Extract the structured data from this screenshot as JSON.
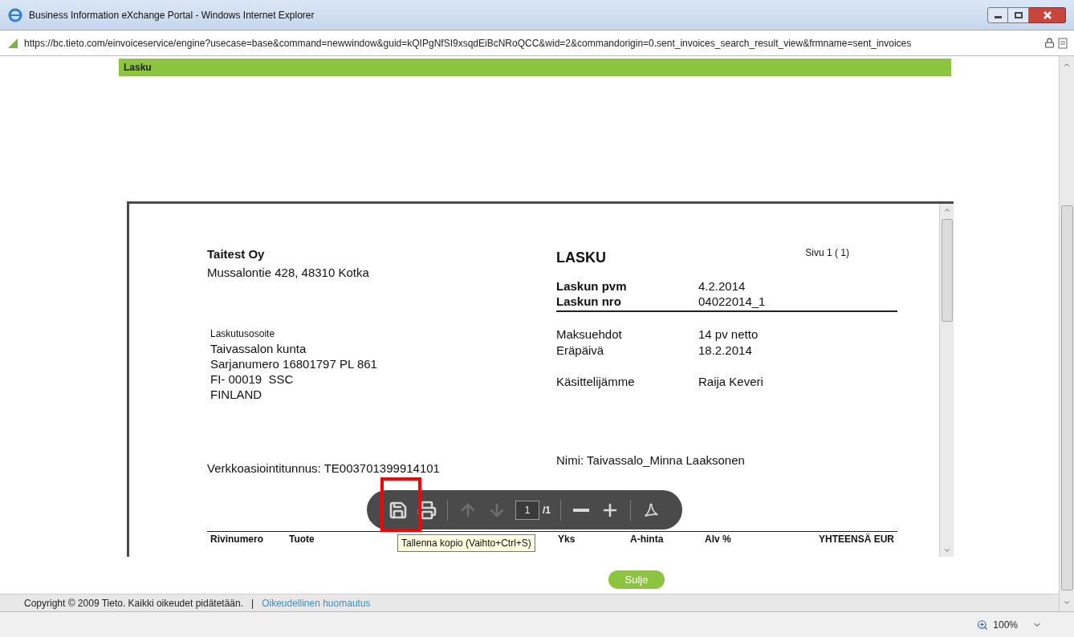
{
  "window": {
    "title": "Business Information eXchange Portal - Windows Internet Explorer"
  },
  "address_bar": {
    "url": "https://bc.tieto.com/einvoiceservice/engine?usecase=base&command=newwindow&guid=kQIPgNfSI9xsqdEiBcNRoQCC&wid=2&commandorigin=0.sent_invoices_search_result_view&frmname=sent_invoices"
  },
  "section_bar": {
    "title": "Lasku"
  },
  "invoice": {
    "seller": {
      "name": "Taitest Oy",
      "address": "Mussalontie 428, 48310 Kotka"
    },
    "title": "LASKU",
    "page": "Sivu 1 ( 1)",
    "header_fields": [
      {
        "label": "Laskun pvm",
        "value": "4.2.2014"
      },
      {
        "label": "Laskun nro",
        "value": "04022014_1"
      }
    ],
    "billing_address": {
      "label": "Laskutusosoite",
      "lines": [
        "Taivassalon kunta",
        "Sarjanumero 16801797 PL 861",
        "FI- 00019  SSC",
        "FINLAND"
      ]
    },
    "terms": [
      {
        "label": "Maksuehdot",
        "value": "14 pv netto"
      },
      {
        "label": "Eräpäivä",
        "value": "18.2.2014"
      }
    ],
    "handler": {
      "label": "Käsittelijämme",
      "value": "Raija Keveri"
    },
    "name_line": "Nimi: Taivassalo_Minna Laaksonen",
    "e_invoice_id": "Verkkoasiointitunnus: TE003701399914101",
    "table": {
      "columns": [
        "Rivinumero",
        "Tuote",
        "Yks",
        "A-hinta",
        "Alv %",
        "YHTEENSÄ EUR"
      ]
    }
  },
  "pdf_toolbar": {
    "items": [
      {
        "kind": "save",
        "disabled": false
      },
      {
        "kind": "print",
        "disabled": false
      },
      {
        "kind": "separator"
      },
      {
        "kind": "prev",
        "disabled": true
      },
      {
        "kind": "next",
        "disabled": true
      },
      {
        "kind": "page",
        "value": "1",
        "total": "/1"
      },
      {
        "kind": "separator"
      },
      {
        "kind": "zoom_out",
        "disabled": false
      },
      {
        "kind": "zoom_in",
        "disabled": false
      },
      {
        "kind": "separator"
      },
      {
        "kind": "acrobat",
        "disabled": false
      }
    ]
  },
  "tooltip": {
    "text": "Tallenna kopio (Vaihto+Ctrl+S)"
  },
  "close_button": {
    "label": "Sulje"
  },
  "footer": {
    "copyright": "Copyright © 2009 Tieto. Kaikki oikeudet pidätetään.",
    "separator": "|",
    "link": "Oikeudellinen huomautus"
  },
  "status_bar": {
    "zoom": "100%"
  }
}
